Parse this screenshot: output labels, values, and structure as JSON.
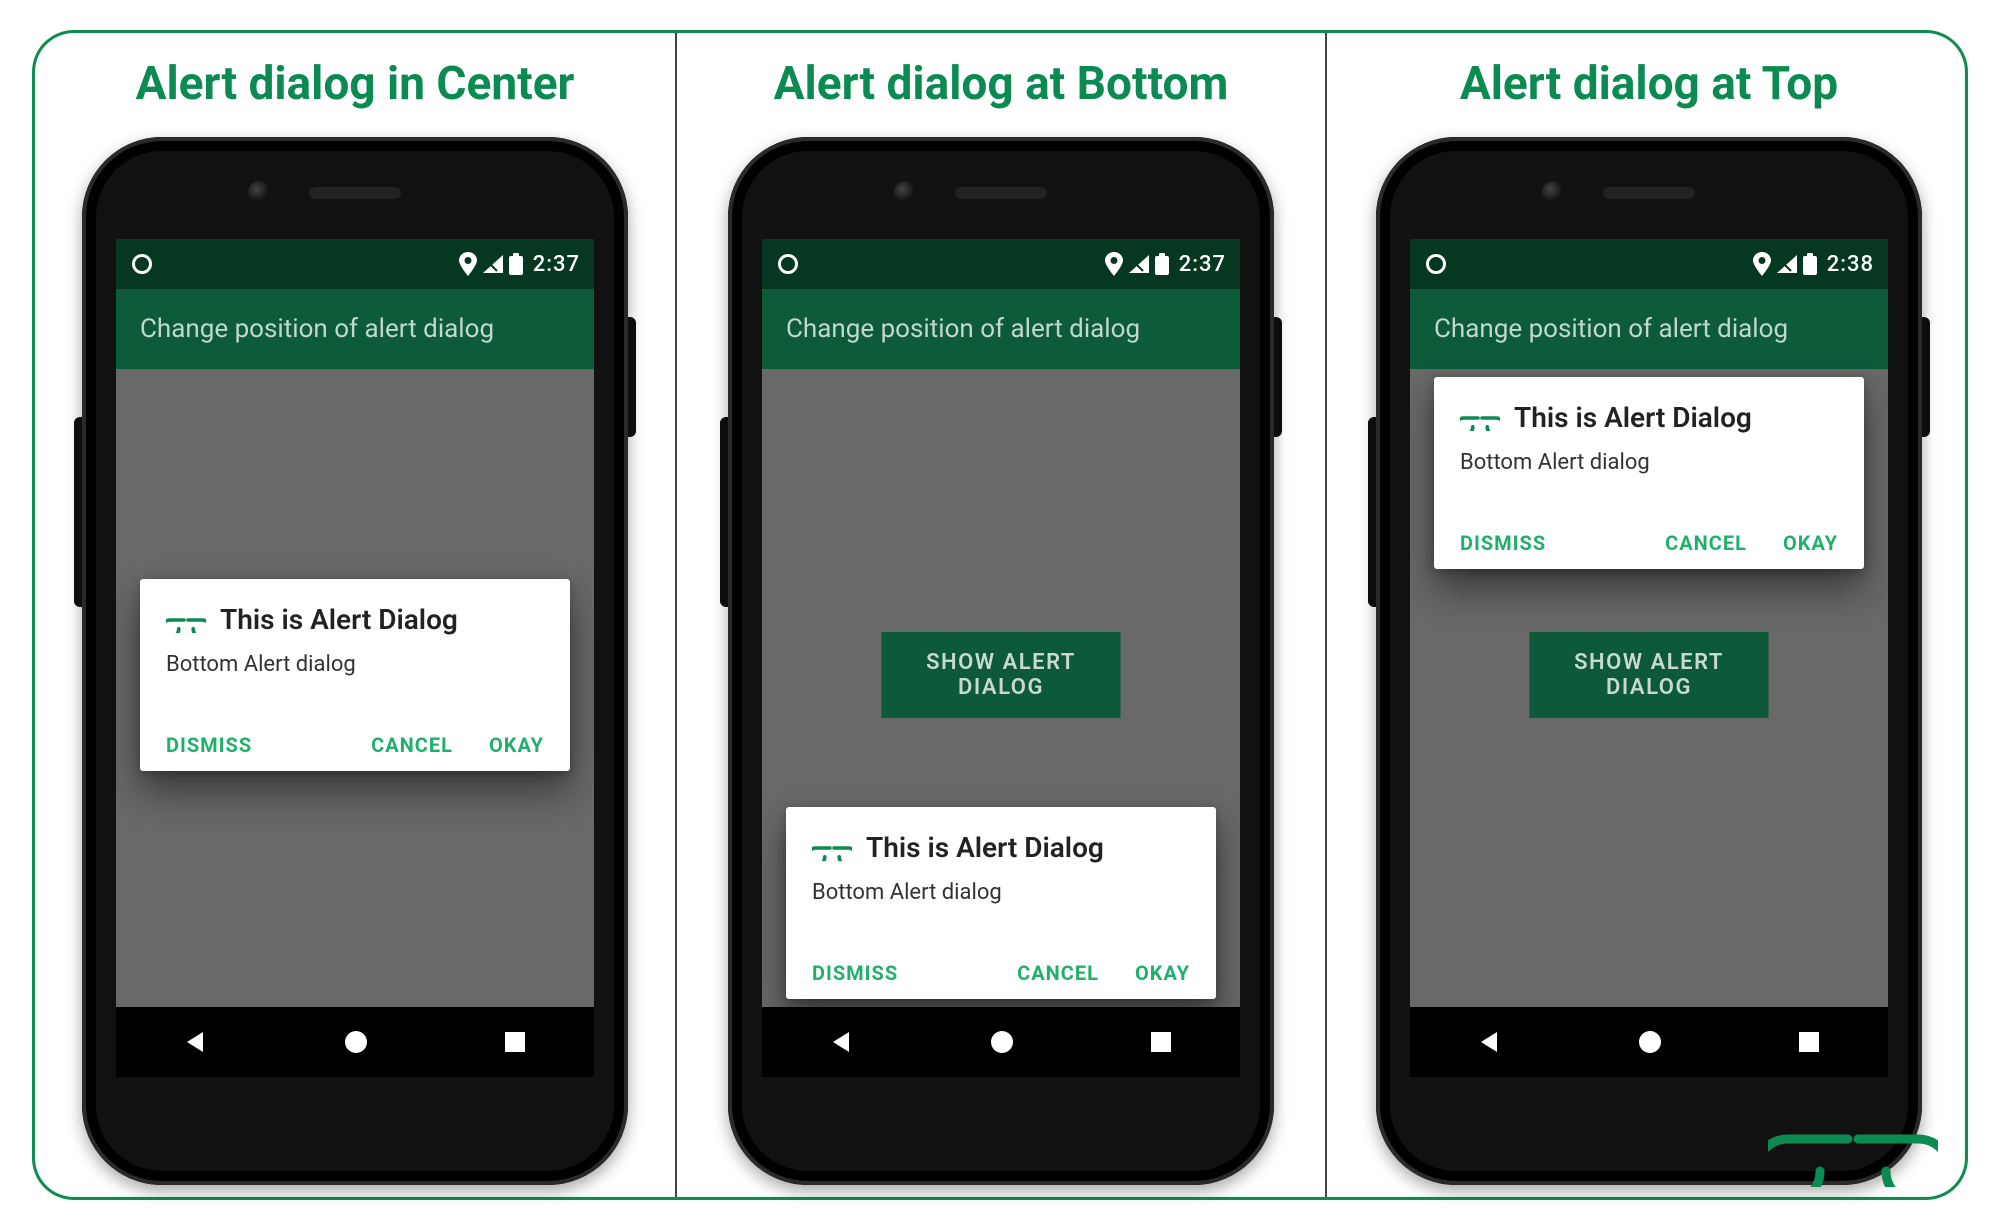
{
  "columns": [
    {
      "title": "Alert dialog in Center"
    },
    {
      "title": "Alert dialog at Bottom"
    },
    {
      "title": "Alert dialog at Top"
    }
  ],
  "statusbar": {
    "times": [
      "2:37",
      "2:37",
      "2:38"
    ]
  },
  "appbar": {
    "title": "Change position of alert dialog"
  },
  "button": {
    "label": "SHOW ALERT DIALOG"
  },
  "dialog": {
    "title": "This is Alert Dialog",
    "message": "Bottom Alert dialog",
    "actions": {
      "dismiss": "DISMISS",
      "cancel": "CANCEL",
      "okay": "OKAY"
    }
  }
}
